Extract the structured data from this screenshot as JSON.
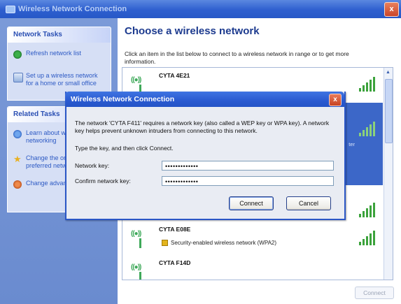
{
  "window": {
    "title": "Wireless Network Connection",
    "close_glyph": "x"
  },
  "taskpane": {
    "network_tasks": {
      "title": "Network Tasks",
      "items": [
        {
          "label": "Refresh network list",
          "icon": "refresh-icon"
        },
        {
          "label": "Set up a wireless network for a home or small office",
          "icon": "setup-network-icon"
        }
      ]
    },
    "related_tasks": {
      "title": "Related Tasks",
      "items": [
        {
          "label": "Learn about wireless networking",
          "icon": "help-icon"
        },
        {
          "label": "Change the order of preferred networks",
          "icon": "star-icon"
        },
        {
          "label": "Change advanced settings",
          "icon": "settings-icon"
        }
      ]
    }
  },
  "main": {
    "heading": "Choose a wireless network",
    "description": "Click an item in the list below to connect to a wireless network in range or to get more information.",
    "networks": [
      {
        "ssid": "CYTA 4E21",
        "security": "",
        "signal_bars": 4
      },
      {
        "ssid": "",
        "security": "",
        "signal_bars": 4,
        "selected": true,
        "side_text": "ter"
      },
      {
        "ssid": "",
        "security": "",
        "signal_bars": 4
      },
      {
        "ssid": "CYTA E08E",
        "security": "Security-enabled wireless network (WPA2)",
        "signal_bars": 4
      },
      {
        "ssid": "CYTA F14D",
        "security": "",
        "signal_bars": 0
      }
    ],
    "connect_button": "Connect"
  },
  "dialog": {
    "title": "Wireless Network Connection",
    "close_glyph": "x",
    "message": "The network 'CYTA F411' requires a network key (also called a WEP key or WPA key). A network key helps prevent unknown intruders from connecting to this network.",
    "instruction": "Type the key, and then click Connect.",
    "network_key_label": "Network key:",
    "network_key_value": "•••••••••••••",
    "confirm_key_label": "Confirm network key:",
    "confirm_key_value": "•••••••••••••",
    "connect_label": "Connect",
    "cancel_label": "Cancel"
  },
  "colors": {
    "title_blue": "#2a5ad0",
    "selection": "#3c67c8",
    "link": "#2d5ac4"
  }
}
